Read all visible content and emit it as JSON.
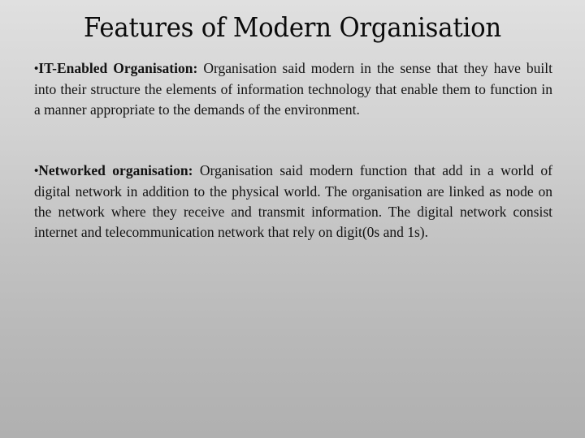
{
  "slide": {
    "title": "Features of Modern Organisation",
    "background": {
      "gradient_from": "#dcdcdc",
      "gradient_to": "#b0b0b0",
      "direction": "top-to-bottom"
    },
    "text_color": "#111111",
    "bullets": [
      {
        "marker": "•",
        "lead_in": "IT-Enabled Organisation:",
        "body": " Organisation said modern in the sense that they have built into their structure the elements of information technology that enable them to function in a manner appropriate to the demands of the environment."
      },
      {
        "marker": "•",
        "lead_in": "Networked organisation:",
        "body": " Organisation said modern function that add in a world of digital network in addition to the physical world. The organisation are linked as node on the network where they receive and transmit information. The digital network consist internet and telecommunication network that rely on digit(0s and 1s)."
      }
    ]
  }
}
